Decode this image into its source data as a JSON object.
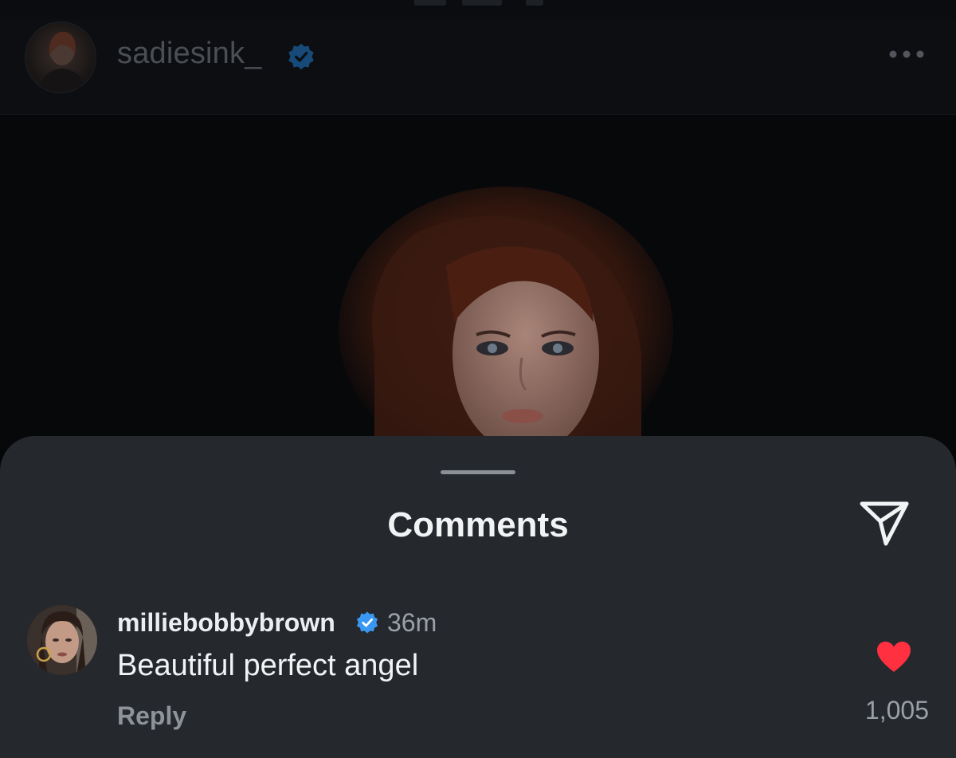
{
  "post": {
    "author": {
      "username": "sadiesink_",
      "verified": true,
      "avatar_icon": "profile-photo"
    },
    "more_icon": "more-dots-icon",
    "photo": "portrait-photo"
  },
  "comments_sheet": {
    "title": "Comments",
    "share_icon": "paper-plane-icon",
    "comments": [
      {
        "username": "milliebobbybrown",
        "verified": true,
        "time": "36m",
        "text": "Beautiful perfect angel",
        "reply_label": "Reply",
        "liked": true,
        "like_count": "1,005"
      }
    ]
  },
  "colors": {
    "verified_blue": "#3a98f3",
    "heart_red": "#ff3040",
    "sheet_bg": "#25282d"
  }
}
